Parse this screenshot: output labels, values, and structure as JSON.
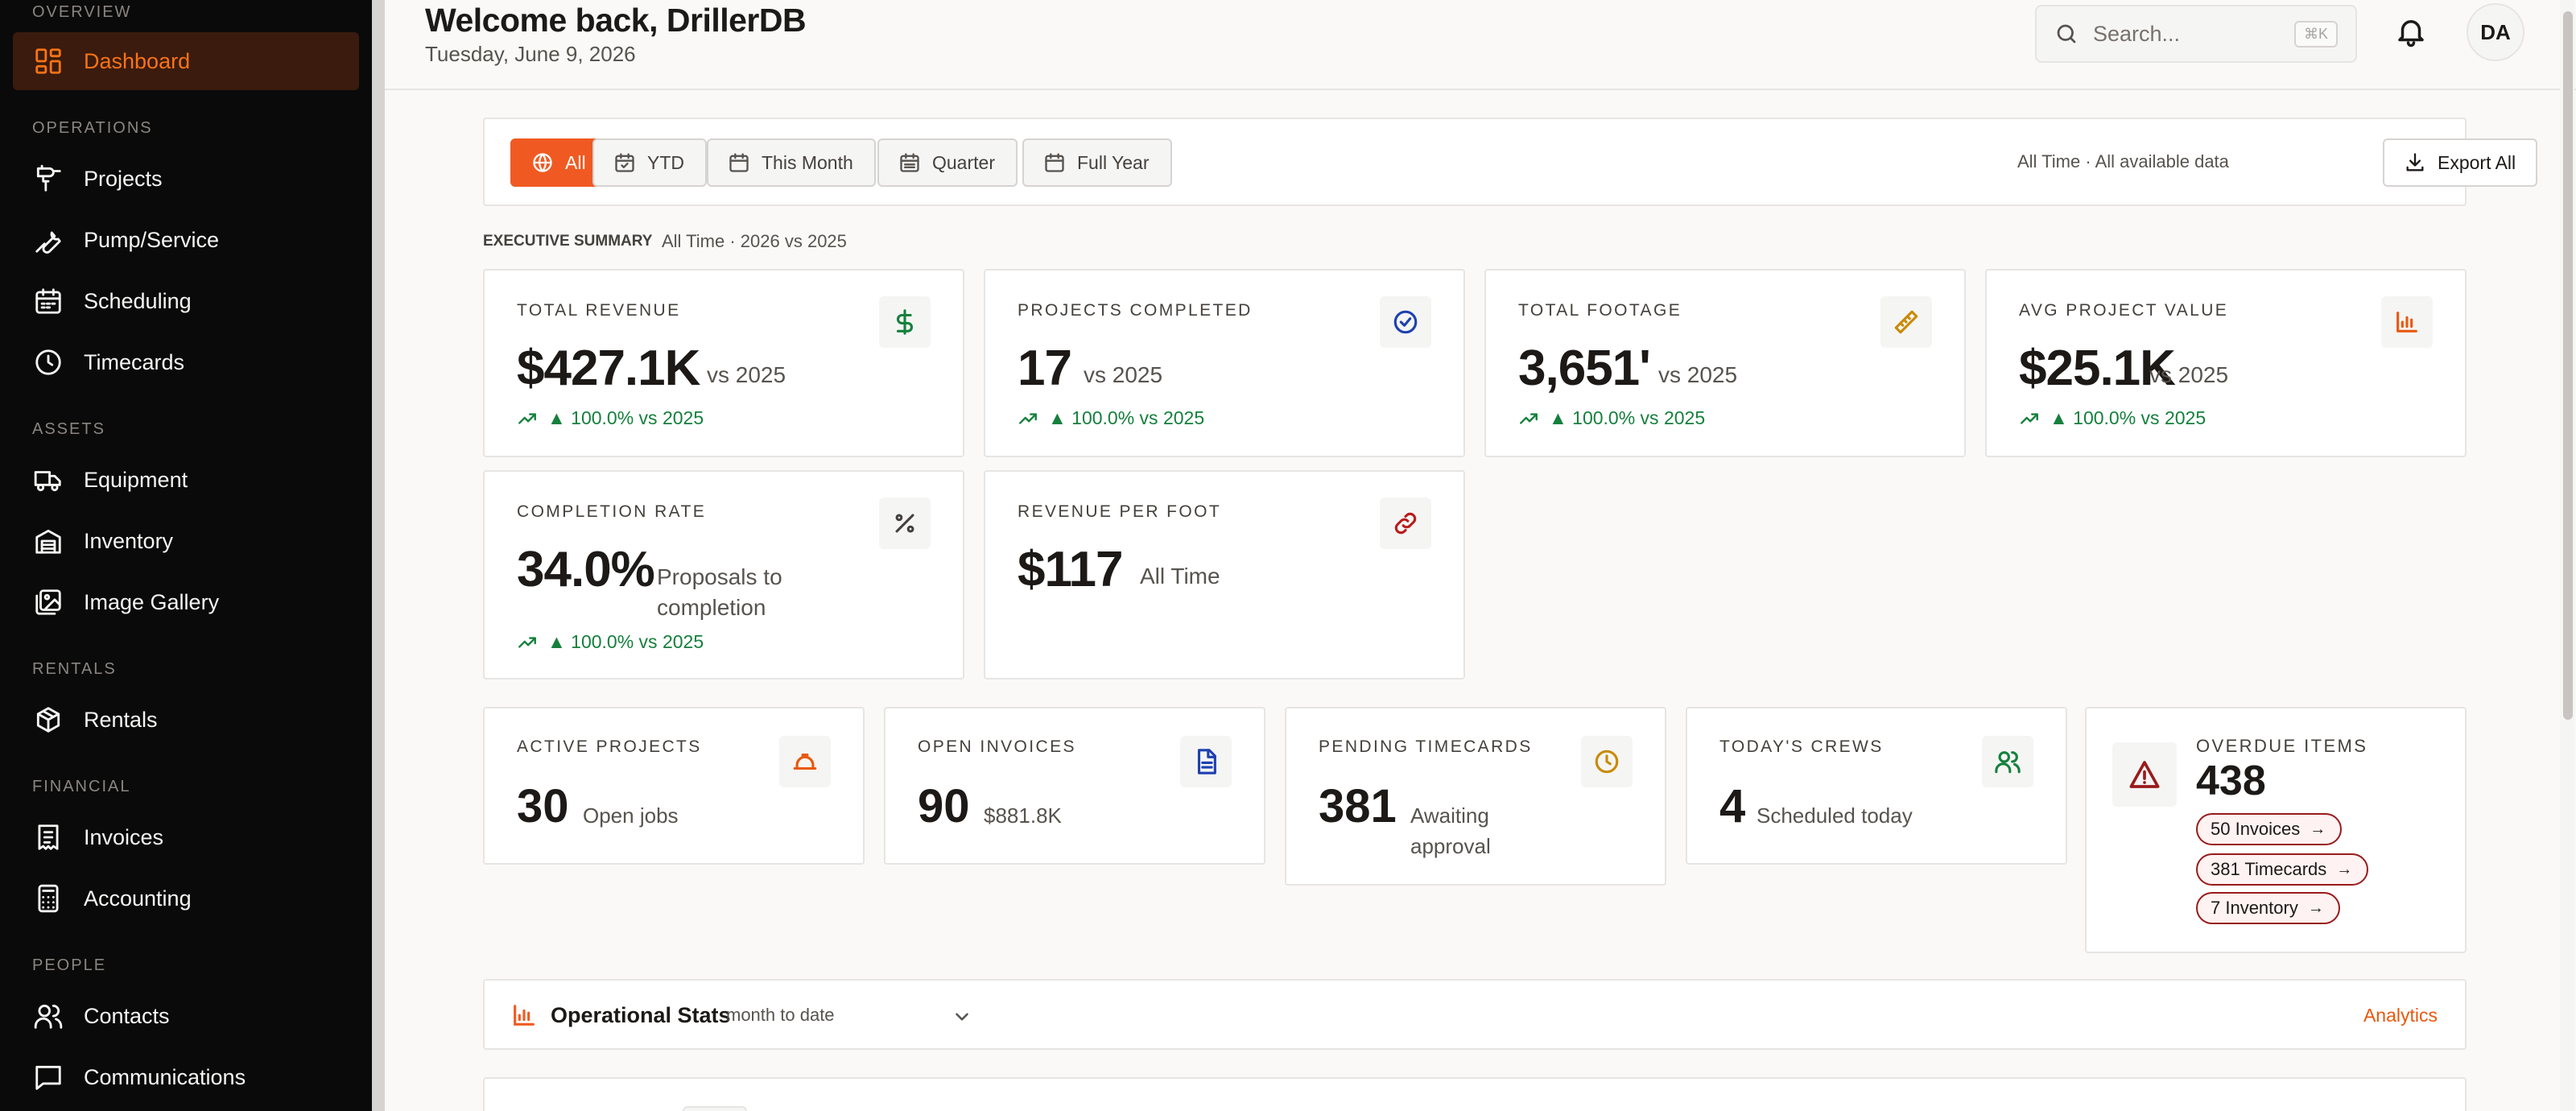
{
  "sidebar": {
    "sections": [
      {
        "label": "OVERVIEW"
      },
      {
        "label": "OPERATIONS"
      },
      {
        "label": "ASSETS"
      },
      {
        "label": "RENTALS"
      },
      {
        "label": "FINANCIAL"
      },
      {
        "label": "PEOPLE"
      }
    ],
    "items": [
      {
        "label": "Dashboard",
        "icon": "dashboard-icon",
        "active": true
      },
      {
        "label": "Projects",
        "icon": "drill-icon"
      },
      {
        "label": "Pump/Service",
        "icon": "wrench-icon"
      },
      {
        "label": "Scheduling",
        "icon": "calendar-icon"
      },
      {
        "label": "Timecards",
        "icon": "clock-icon"
      },
      {
        "label": "Equipment",
        "icon": "truck-icon"
      },
      {
        "label": "Inventory",
        "icon": "warehouse-icon"
      },
      {
        "label": "Image Gallery",
        "icon": "image-icon"
      },
      {
        "label": "Rentals",
        "icon": "package-icon"
      },
      {
        "label": "Invoices",
        "icon": "receipt-icon"
      },
      {
        "label": "Accounting",
        "icon": "calculator-icon"
      },
      {
        "label": "Contacts",
        "icon": "users-icon"
      },
      {
        "label": "Communications",
        "icon": "message-icon"
      }
    ]
  },
  "header": {
    "welcome": "Welcome back, DrillerDB",
    "date": "Tuesday, June 9, 2026",
    "search_placeholder": "Search...",
    "search_shortcut": "⌘K",
    "avatar_initials": "DA"
  },
  "filters": {
    "buttons": [
      {
        "label": "All",
        "icon": "globe-icon",
        "active": true
      },
      {
        "label": "YTD",
        "icon": "calendar-check-icon"
      },
      {
        "label": "This Month",
        "icon": "calendar-icon"
      },
      {
        "label": "Quarter",
        "icon": "calendar-icon"
      },
      {
        "label": "Full Year",
        "icon": "calendar-icon"
      }
    ],
    "range_text": "All Time · All available data",
    "export_label": "Export All"
  },
  "executive_summary": {
    "label": "EXECUTIVE SUMMARY",
    "sub": "All Time · 2026 vs 2025"
  },
  "kpis": [
    {
      "title": "TOTAL REVENUE",
      "value": "$427.1K",
      "sub": "vs 2025",
      "trend": "▲ 100.0% vs 2025",
      "icon": "dollar-icon",
      "color": "#15803d"
    },
    {
      "title": "PROJECTS COMPLETED",
      "value": "17",
      "sub": "vs 2025",
      "trend": "▲ 100.0% vs 2025",
      "icon": "check-circle-icon",
      "color": "#1e40af"
    },
    {
      "title": "TOTAL FOOTAGE",
      "value": "3,651'",
      "sub": "vs 2025",
      "trend": "▲ 100.0% vs 2025",
      "icon": "ruler-icon",
      "color": "#ca8a04"
    },
    {
      "title": "AVG PROJECT VALUE",
      "value": "$25.1K",
      "sub": "vs 2025",
      "trend": "▲ 100.0% vs 2025",
      "icon": "bar-chart-icon",
      "color": "#ea580c"
    },
    {
      "title": "COMPLETION RATE",
      "value": "34.0%",
      "sub": "Proposals to completion",
      "trend": "▲ 100.0% vs 2025",
      "icon": "percent-icon",
      "color": "#44403c"
    },
    {
      "title": "REVENUE PER FOOT",
      "value": "$117",
      "sub": "All Time",
      "icon": "link-icon",
      "color": "#b91c1c"
    }
  ],
  "ops_cards": [
    {
      "title": "ACTIVE PROJECTS",
      "value": "30",
      "sub": "Open jobs",
      "icon": "hardhat-icon",
      "color": "#ea580c"
    },
    {
      "title": "OPEN INVOICES",
      "value": "90",
      "sub": "$881.8K",
      "icon": "file-icon",
      "color": "#1e40af"
    },
    {
      "title": "PENDING TIMECARDS",
      "value": "381",
      "sub": "Awaiting approval",
      "icon": "clock-icon",
      "color": "#ca8a04"
    },
    {
      "title": "TODAY'S CREWS",
      "value": "4",
      "sub": "Scheduled today",
      "icon": "users-icon",
      "color": "#15803d"
    }
  ],
  "overdue": {
    "title": "OVERDUE ITEMS",
    "value": "438",
    "pills": [
      {
        "label": "50 Invoices"
      },
      {
        "label": "381 Timecards"
      },
      {
        "label": "7 Inventory"
      }
    ]
  },
  "operational_stats": {
    "title": "Operational Stats",
    "period": "month to date",
    "link": "Analytics"
  },
  "colors": {
    "accent": "#f05a22",
    "trend_up": "#15803d",
    "danger": "#991b1b"
  }
}
